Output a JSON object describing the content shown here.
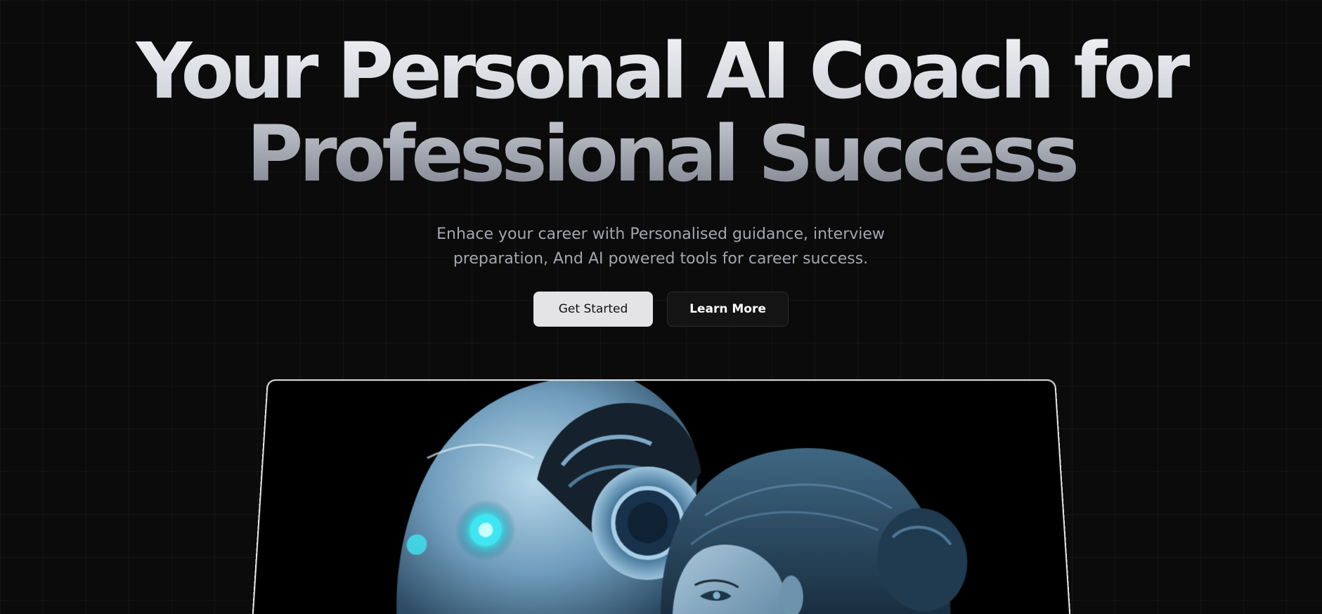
{
  "hero": {
    "title_line1": "Your Personal AI Coach for",
    "title_line2": "Professional Success",
    "subtitle": "Enhace your career with Personalised guidance, interview preparation, And AI powered tools for career success."
  },
  "buttons": {
    "get_started": "Get Started",
    "learn_more": "Learn More"
  },
  "image": {
    "description_icon": "robot-and-woman-illustration"
  },
  "colors": {
    "background": "#0b0b0c",
    "primary_button": "#e4e4e6",
    "secondary_button": "#141415",
    "robot_eye": "#3fe6f2"
  }
}
